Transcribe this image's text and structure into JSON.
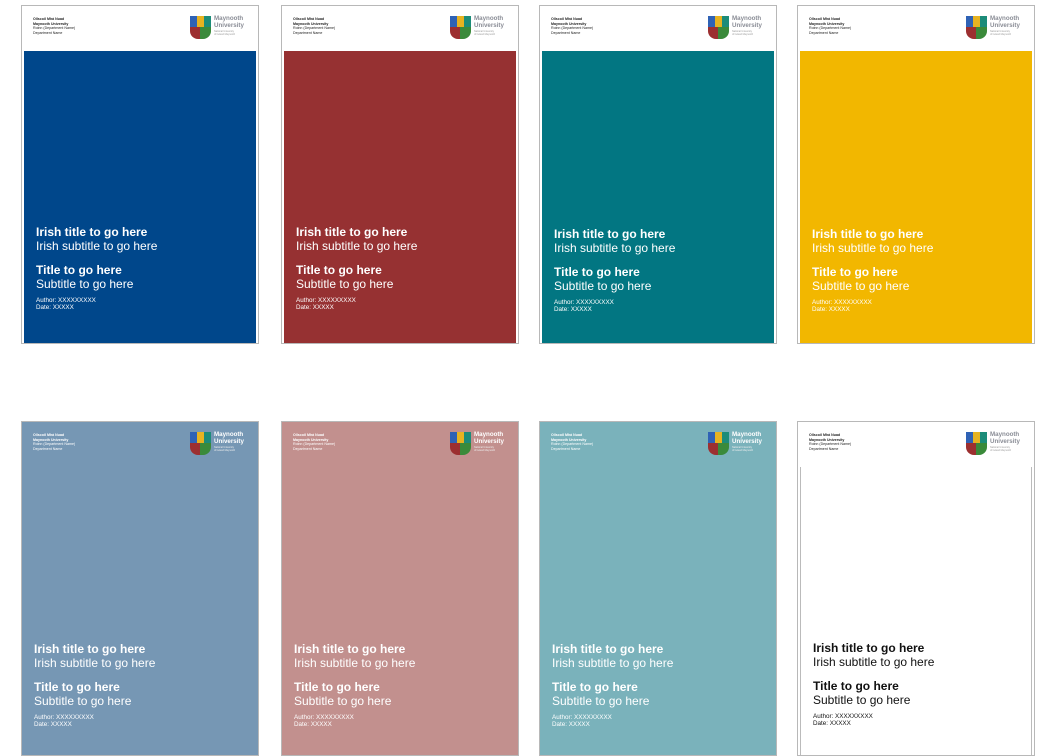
{
  "address": {
    "line1": "Ollscoil Mhá Nuad",
    "line2": "Maynooth University",
    "line3": "Roinn (Department Name)",
    "line4": "Department Name"
  },
  "logo": {
    "name_line1": "Maynooth",
    "name_line2": "University",
    "sub_line1": "National University",
    "sub_line2": "of Ireland Maynooth",
    "colors": [
      "#2f62b5",
      "#e7b321",
      "#1c8c79",
      "#9c2f30",
      "#3a8a3a"
    ]
  },
  "cover": {
    "irish_title": "Irish title to go here",
    "irish_subtitle": "Irish subtitle to go here",
    "title": "Title to go here",
    "subtitle": "Subtitle to go here",
    "author": "Author: XXXXXXXXX",
    "date": "Date: XXXXX"
  },
  "templates": [
    {
      "color": "#00478b"
    },
    {
      "color": "#963132"
    },
    {
      "color": "#027682"
    },
    {
      "color": "#f2b700"
    },
    {
      "color": "#7697b4"
    },
    {
      "color": "#c2908e"
    },
    {
      "color": "#7ab2bb"
    },
    {
      "color": "#ffffff"
    }
  ]
}
